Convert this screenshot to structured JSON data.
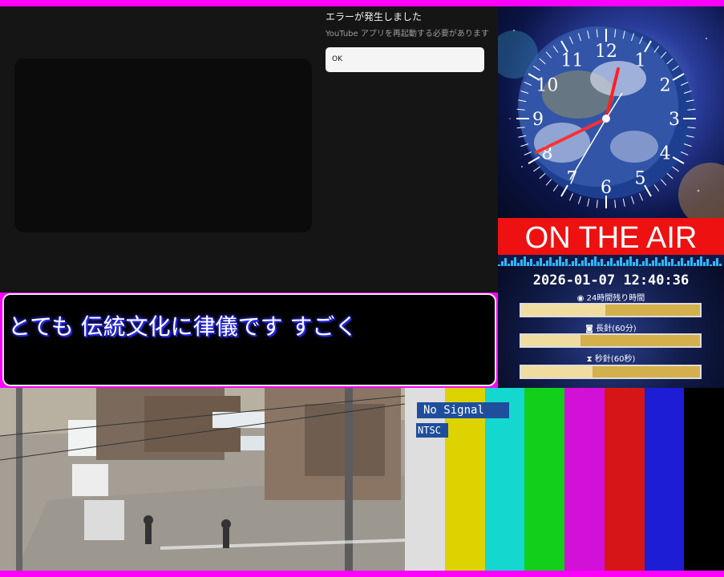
{
  "dialog": {
    "title": "エラーが発生しました",
    "message": "YouTube アプリを再起動する必要があります",
    "ok_label": "OK"
  },
  "caption": {
    "text": "とても 伝統文化に律儀です すごく"
  },
  "clock": {
    "numerals": [
      "12",
      "1",
      "2",
      "3",
      "4",
      "5",
      "6",
      "7",
      "8",
      "9",
      "10",
      "11"
    ],
    "time": "12:40:36"
  },
  "onair": {
    "label": "ON THE AIR"
  },
  "countdown": {
    "datetime": "2026-01-07 12:40:36",
    "day_label": "24時間残り時間",
    "minute_label": "長針(60分)",
    "second_label": "秒針(60秒)",
    "day_remaining_fraction": 0.47,
    "minute_remaining_fraction": 0.33,
    "second_remaining_fraction": 0.4
  },
  "testcard": {
    "no_signal": "No Signal",
    "standard": "NTSC",
    "bar_colors": [
      "#dedede",
      "#dcd300",
      "#14d8d0",
      "#12cf1a",
      "#d210d8",
      "#d61616",
      "#1d1dd6",
      "#000000"
    ]
  },
  "colors": {
    "frame": "#ff00ff",
    "onair_red": "#ee1111",
    "caption_glow": "#4040ff"
  }
}
